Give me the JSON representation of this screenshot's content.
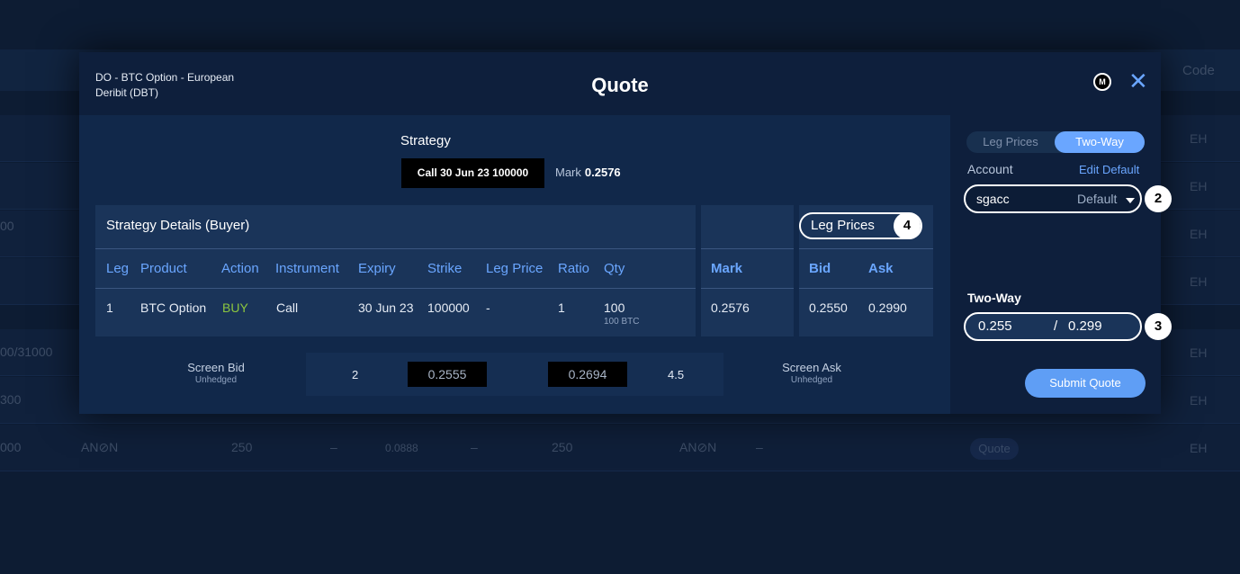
{
  "background": {
    "header_right": "Code",
    "right_col": [
      "EH",
      "EH",
      "EH",
      "EH",
      "EH",
      "EH",
      "EH"
    ],
    "left_col": [
      "00",
      "00/31000",
      "300",
      "000"
    ],
    "bottom_row": {
      "anon1": "AN⊘N",
      "qty1": "250",
      "dash1": "–",
      "mid": "0.0888",
      "dash2": "–",
      "qty2": "250",
      "anon2": "AN⊘N",
      "dash3": "–",
      "quote": "Quote"
    }
  },
  "modal": {
    "product_line1": "DO - BTC Option - European",
    "product_line2": "Deribit (DBT)",
    "title": "Quote",
    "m_icon": "M",
    "close_icon": "✕",
    "strategy_label": "Strategy",
    "strategy_chip": "Call  30 Jun 23  100000",
    "mark_label": "Mark",
    "mark_value": "0.2576",
    "details_title": "Strategy Details (Buyer)",
    "columns": [
      "Leg",
      "Product",
      "Action",
      "Instrument",
      "Expiry",
      "Strike",
      "Leg Price",
      "Ratio",
      "Qty"
    ],
    "row": {
      "leg": "1",
      "product": "BTC Option",
      "action": "BUY",
      "instrument": "Call",
      "expiry": "30 Jun 23",
      "strike": "100000",
      "leg_price": "-",
      "ratio": "1",
      "qty": "100",
      "qty_sub": "100 BTC"
    },
    "mark_col_head": "Mark",
    "mark_col_value": "0.2576",
    "leg_prices_label": "Leg Prices",
    "bid_head": "Bid",
    "ask_head": "Ask",
    "bid_value": "0.2550",
    "ask_value": "0.2990",
    "screen_bid_label": "Screen Bid",
    "screen_bid_sub": "Unhedged",
    "screen_bid_size": "2",
    "screen_bid_price": "0.2555",
    "screen_ask_price": "0.2694",
    "screen_ask_size": "4.5",
    "screen_ask_label": "Screen Ask",
    "screen_ask_sub": "Unhedged"
  },
  "side": {
    "toggle_leg": "Leg Prices",
    "toggle_twoway": "Two-Way",
    "account_label": "Account",
    "edit_default": "Edit Default",
    "account_value": "sgacc",
    "account_default": "Default",
    "twoway_label": "Two-Way",
    "bid": "0.255",
    "slash": "/",
    "ask": "0.299",
    "submit": "Submit Quote"
  },
  "badges": {
    "b2": "2",
    "b3": "3",
    "b4": "4"
  },
  "colors": {
    "accent": "#6aa6ff",
    "buy": "#8cc63f",
    "background": "#0d1c33"
  }
}
